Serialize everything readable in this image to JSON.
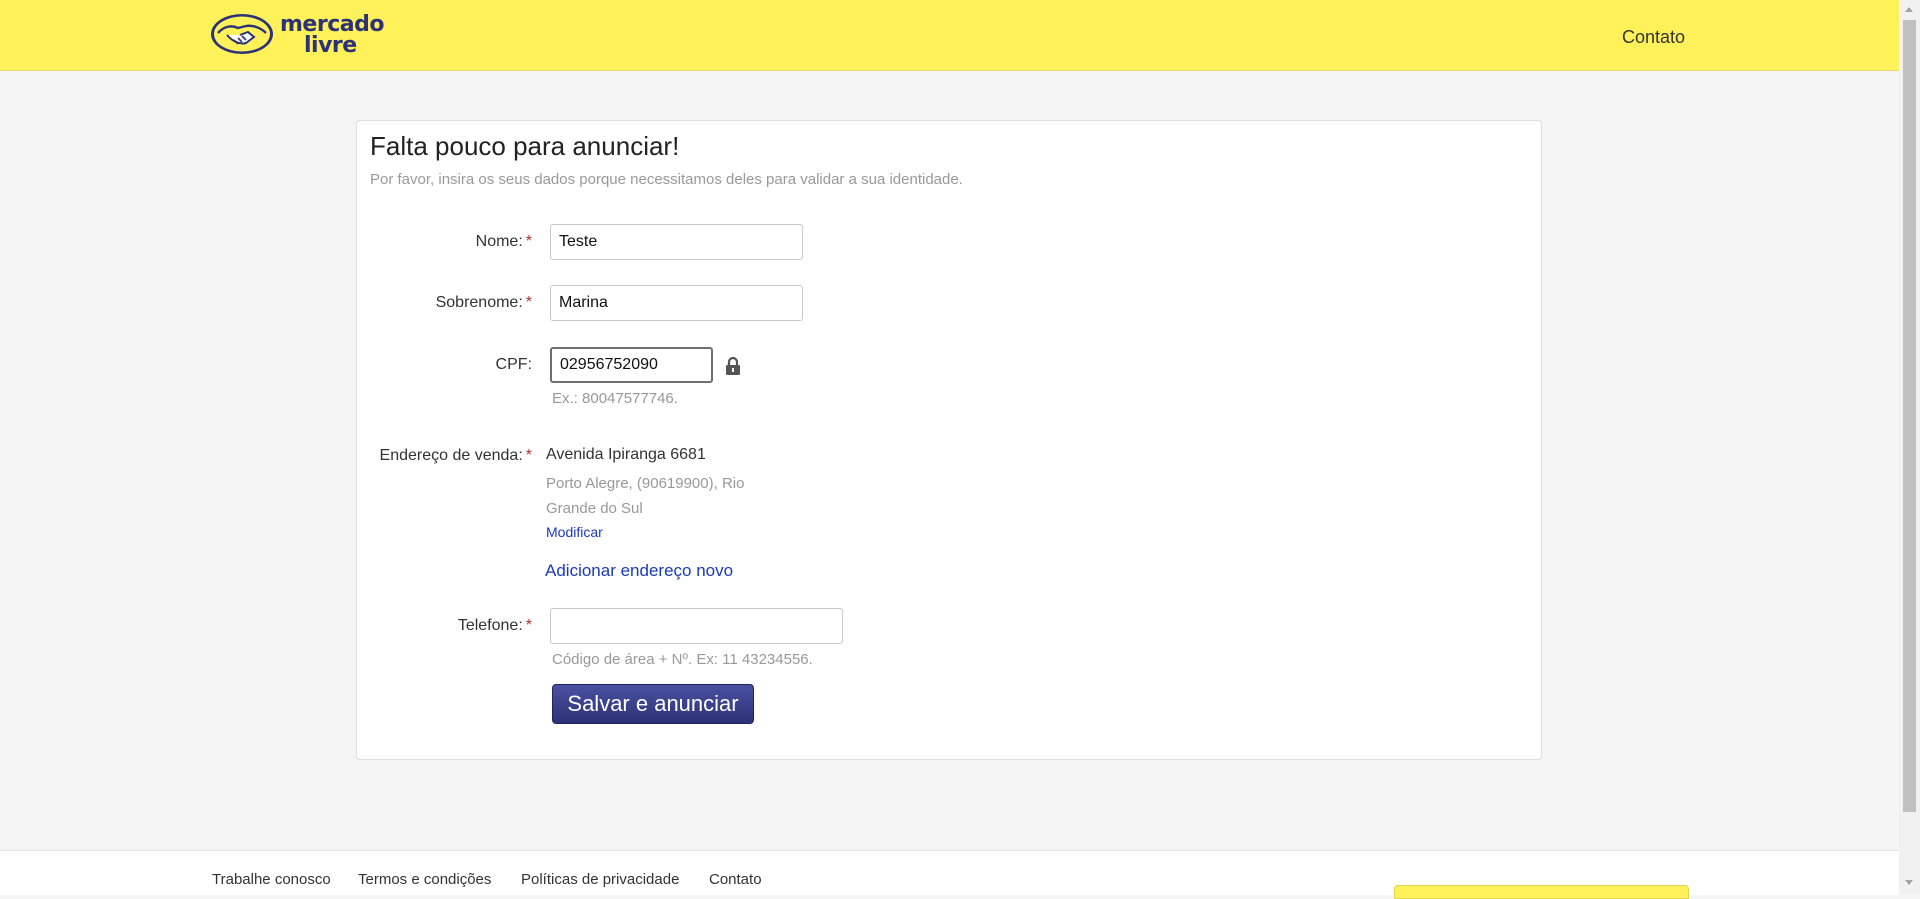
{
  "header": {
    "logo_text_line1": "mercado",
    "logo_text_line2": "livre",
    "contact_link": "Contato",
    "bg_color": "#fff159",
    "brand_color": "#2d3277"
  },
  "form": {
    "title": "Falta pouco para anunciar!",
    "subtitle": "Por favor, insira os seus dados porque necessitamos deles para validar a sua identidade.",
    "required_mark": "*",
    "nome": {
      "label": "Nome:",
      "value": "Teste"
    },
    "sobrenome": {
      "label": "Sobrenome:",
      "value": "Marina"
    },
    "cpf": {
      "label": "CPF:",
      "value": "02956752090",
      "hint": "Ex.: 80047577746.",
      "icon": "lock-icon"
    },
    "endereco": {
      "label": "Endereço de venda:",
      "street": "Avenida Ipiranga 6681",
      "city_line": "Porto Alegre, (90619900), Rio Grande do Sul",
      "modify_link": "Modificar",
      "add_new_link": "Adicionar endereço novo"
    },
    "telefone": {
      "label": "Telefone:",
      "value": "",
      "hint": "Código de área + Nº. Ex: 11 43234556."
    },
    "submit_label": "Salvar e anunciar",
    "link_color": "#1b3ab8",
    "required_color": "#b4322f"
  },
  "footer": {
    "links": [
      "Trabalhe conosco",
      "Termos e condições",
      "Políticas de privacidade",
      "Contato"
    ]
  }
}
